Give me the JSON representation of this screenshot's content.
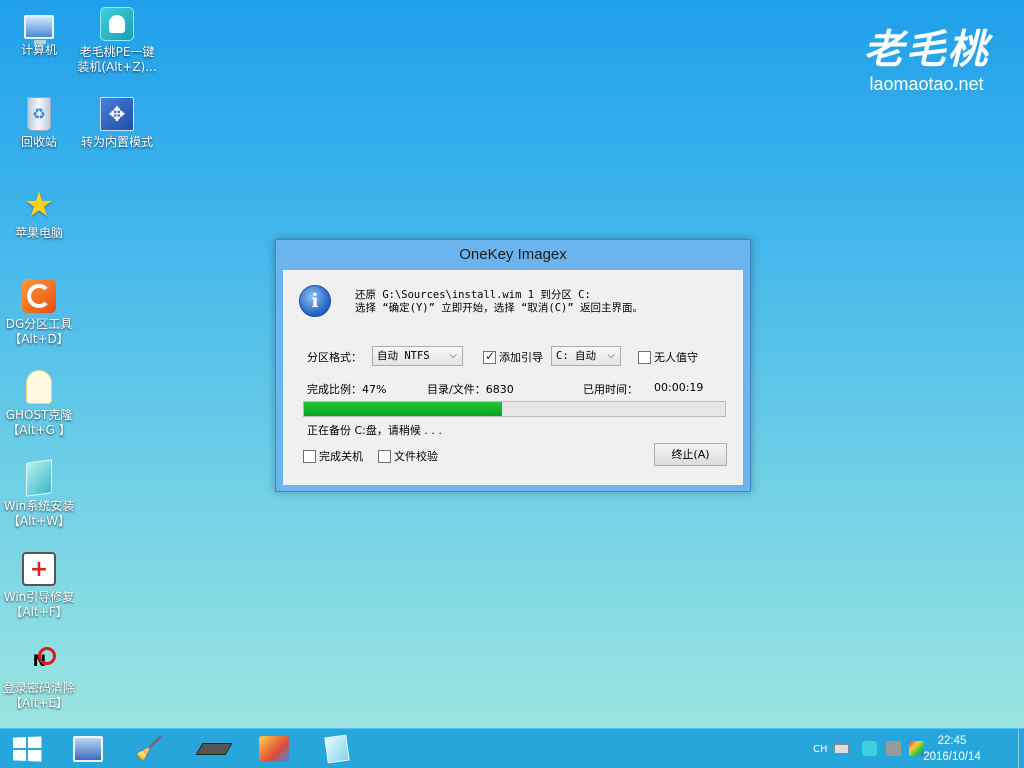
{
  "desktop": {
    "icons": [
      {
        "name": "计算机",
        "icon": "computer-icon"
      },
      {
        "name": "老毛桃PE一键\n装机(Alt+Z)...",
        "icon": "ghost-installer-icon"
      },
      {
        "name": "回收站",
        "icon": "recycle-bin-icon"
      },
      {
        "name": "转为内置模式",
        "icon": "mode-switch-icon"
      },
      {
        "name": "苹果电脑",
        "icon": "star-icon"
      },
      {
        "name": "DG分区工具\n【Alt+D】",
        "icon": "diskgenius-icon"
      },
      {
        "name": "GHOST克隆\n【Alt+G 】",
        "icon": "ghost-icon"
      },
      {
        "name": "Win系统安装\n【Alt+W】",
        "icon": "windows-install-icon"
      },
      {
        "name": "Win引导修复\n【Alt+F】",
        "icon": "repair-kit-icon"
      },
      {
        "name": "登录密码清除\n【Alt+E】",
        "icon": "nt-password-icon"
      }
    ]
  },
  "logo": {
    "zh": "老毛桃",
    "en": "laomaotao.net"
  },
  "dialog": {
    "title": "OneKey Imagex",
    "message_line1": "还原 G:\\Sources\\install.wim 1 到分区 C:",
    "message_line2": "选择 “确定(Y)” 立即开始，选择 “取消(C)” 返回主界面。",
    "partition_format_label": "分区格式：",
    "partition_format_value": "自动 NTFS",
    "add_boot_label": "添加引导",
    "add_boot_checked": true,
    "boot_drive_value": "C: 自动",
    "unattended_label": "无人值守",
    "unattended_checked": false,
    "progress_label": "完成比例：47%",
    "files_label": "目录/文件：6830",
    "elapsed_label": "已用时间：",
    "elapsed_value": "00:00:19",
    "progress_value": 47,
    "status_text": "正在备份 C:盘，请稍候 . . .",
    "shutdown_label": "完成关机",
    "shutdown_checked": false,
    "verify_label": "文件校验",
    "verify_checked": false,
    "abort_button": "终止(A)"
  },
  "taskbar": {
    "tray_lang": "CH",
    "clock_time": "22:45",
    "clock_date": "2016/10/14",
    "apps": [
      "screen-icon",
      "broom-icon",
      "memory-chip-icon",
      "tools-icon",
      "notes-icon"
    ]
  },
  "colors": {
    "progress_fill": "#06a020",
    "taskbar": "#27a6dc",
    "dialog_frame": "#6cb4ee"
  }
}
